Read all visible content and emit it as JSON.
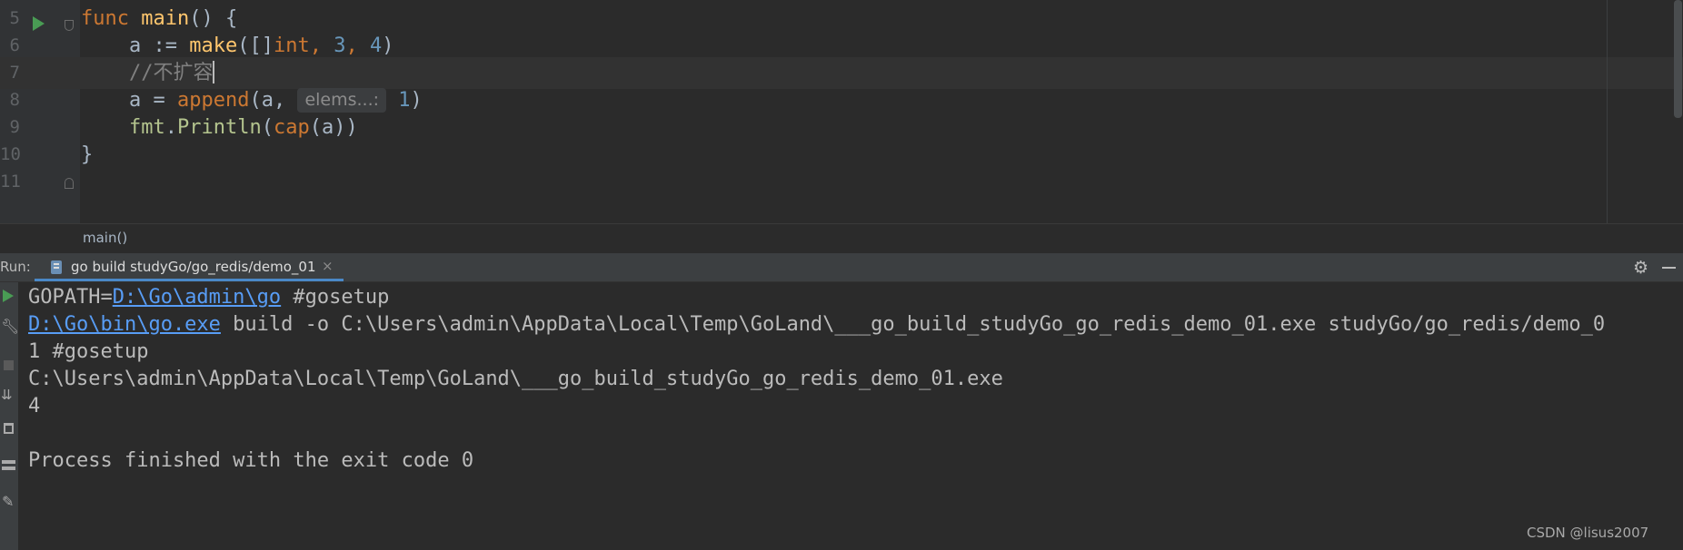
{
  "editor": {
    "lines": [
      {
        "num": "5",
        "tokens": [
          {
            "t": "func ",
            "c": "kw"
          },
          {
            "t": "main",
            "c": "fn"
          },
          {
            "t": "() {",
            "c": ""
          }
        ]
      },
      {
        "num": "6",
        "tokens": [
          {
            "t": "    a := ",
            "c": ""
          },
          {
            "t": "make",
            "c": "fn"
          },
          {
            "t": "([]",
            "c": ""
          },
          {
            "t": "int",
            "c": "kw"
          },
          {
            "t": ", ",
            "c": "kw"
          },
          {
            "t": "3",
            "c": "num"
          },
          {
            "t": ", ",
            "c": "kw"
          },
          {
            "t": "4",
            "c": "num"
          },
          {
            "t": ")",
            "c": ""
          }
        ]
      },
      {
        "num": "7",
        "tokens": [
          {
            "t": "    ",
            "c": ""
          },
          {
            "t": "//不扩容",
            "c": "cmt"
          }
        ],
        "current": true,
        "caret": true
      },
      {
        "num": "8",
        "tokens": [
          {
            "t": "    a = ",
            "c": ""
          },
          {
            "t": "append",
            "c": "kw"
          },
          {
            "t": "(a, ",
            "c": ""
          }
        ],
        "hint": "elems...:",
        "after_hint": [
          {
            "t": "1",
            "c": "num"
          },
          {
            "t": ")",
            "c": ""
          }
        ]
      },
      {
        "num": "9",
        "tokens": [
          {
            "t": "    ",
            "c": ""
          },
          {
            "t": "fmt",
            "c": "call"
          },
          {
            "t": ".",
            "c": ""
          },
          {
            "t": "Println",
            "c": "call"
          },
          {
            "t": "(",
            "c": ""
          },
          {
            "t": "cap",
            "c": "kw"
          },
          {
            "t": "(a))",
            "c": ""
          }
        ]
      },
      {
        "num": "10",
        "tokens": [
          {
            "t": "}",
            "c": ""
          }
        ]
      },
      {
        "num": "11",
        "tokens": []
      }
    ]
  },
  "breadcrumb": {
    "text": "main()"
  },
  "run_panel": {
    "label": "Run:",
    "tab_label": "go build studyGo/go_redis/demo_01",
    "tab_close": "×",
    "settings_icon": "gear-icon",
    "minimize_icon": "minimize-icon"
  },
  "console": {
    "lines": [
      {
        "parts": [
          {
            "t": "GOPATH=",
            "link": false
          },
          {
            "t": "D:\\Go\\admin\\go",
            "link": true
          },
          {
            "t": " #gosetup",
            "link": false
          }
        ]
      },
      {
        "parts": [
          {
            "t": "D:\\Go\\bin\\go.exe",
            "link": true
          },
          {
            "t": " build -o C:\\Users\\admin\\AppData\\Local\\Temp\\GoLand\\___go_build_studyGo_go_redis_demo_01.exe studyGo/go_redis/demo_0",
            "link": false
          }
        ]
      },
      {
        "parts": [
          {
            "t": "1 #gosetup",
            "link": false
          }
        ]
      },
      {
        "parts": [
          {
            "t": "C:\\Users\\admin\\AppData\\Local\\Temp\\GoLand\\___go_build_studyGo_go_redis_demo_01.exe",
            "link": false
          }
        ]
      },
      {
        "parts": [
          {
            "t": "4",
            "link": false
          }
        ]
      },
      {
        "parts": []
      },
      {
        "parts": [
          {
            "t": "Process finished with the exit code 0",
            "link": false
          }
        ]
      }
    ]
  },
  "watermark": "CSDN @lisus2007",
  "colors": {
    "background": "#2b2b2b",
    "keyword": "#cc7832",
    "function": "#ffc66d",
    "number": "#6897bb",
    "link": "#589df6",
    "run_green": "#499c54"
  }
}
